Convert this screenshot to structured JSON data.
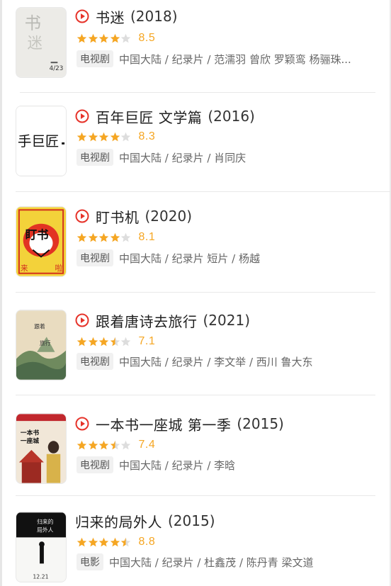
{
  "items": [
    {
      "title": "书迷",
      "year": "(2018)",
      "playable": true,
      "stars": 4,
      "score": "8.5",
      "tag": "电视剧",
      "meta": "中国大陆 / 纪录片 / 范濡羽 曾欣 罗颖鸾 杨骊珠...",
      "poster_icon": "poster-shumi"
    },
    {
      "title": "百年巨匠 文学篇",
      "year": "(2016)",
      "playable": true,
      "stars": 4,
      "score": "8.3",
      "tag": "电视剧",
      "meta": "中国大陆 / 纪录片 / 肖同庆",
      "poster_icon": "poster-bainian"
    },
    {
      "title": "盯书机",
      "year": "(2020)",
      "playable": true,
      "stars": 4,
      "score": "8.1",
      "tag": "电视剧",
      "meta": "中国大陆 / 纪录片 短片 / 杨越",
      "poster_icon": "poster-dingshuji"
    },
    {
      "title": "跟着唐诗去旅行",
      "year": "(2021)",
      "playable": true,
      "stars": 3.5,
      "score": "7.1",
      "tag": "电视剧",
      "meta": "中国大陆 / 纪录片 / 李文举 / 西川 鲁大东",
      "poster_icon": "poster-tangshi"
    },
    {
      "title": "一本书一座城 第一季",
      "year": "(2015)",
      "playable": true,
      "stars": 3.5,
      "score": "7.4",
      "tag": "电视剧",
      "meta": "中国大陆 / 纪录片 / 李晗",
      "poster_icon": "poster-yibenshu"
    },
    {
      "title": "归来的局外人",
      "year": "(2015)",
      "playable": false,
      "stars": 4.5,
      "score": "8.8",
      "tag": "电影",
      "meta": "中国大陆 / 纪录片 / 杜鑫茂 / 陈丹青 梁文道",
      "poster_icon": "poster-guilai"
    }
  ],
  "colors": {
    "accent_red": "#e6332a",
    "star_orange": "#f5a623",
    "star_empty": "#dddddd"
  }
}
